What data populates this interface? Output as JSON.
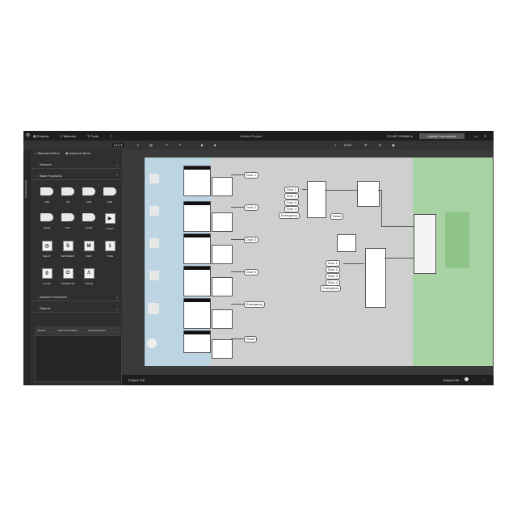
{
  "menubar": {
    "projects": "Projects",
    "modules": "Modules",
    "tools": "Tools",
    "help": "?",
    "title": "Untitled Project",
    "device": "CS-MP-C06860",
    "update_label": "Update Connections"
  },
  "toolbar": {
    "zoom_select": "X12",
    "zoom_level": "120%"
  },
  "sidebar": {
    "vertical_tab": "Project Elements",
    "radio_standard": "Standard Menu",
    "radio_advance": "Advance Menu",
    "sections": {
      "sensors": "Sensors",
      "base_functions": "Base Functions",
      "advance_functions": "Advance Functions",
      "objects": "Objects"
    },
    "base_items": [
      "AND",
      "OR",
      "XOR",
      "NOR",
      "NAND",
      "NOT",
      "NXOR",
      "START",
      "DELAY",
      "SET/RESET",
      "MEM",
      "TRUE",
      "FALSE",
      "POWER ON",
      "PULSE"
    ],
    "true_glyph": "1",
    "false_glyph": "0",
    "bottom_tabs": [
      "Events",
      "Search in Desktop",
      "Load Resources"
    ]
  },
  "diagram": {
    "outputs": [
      "Door 1",
      "Door 2",
      "Door 3",
      "Door 4",
      "Emergency",
      "Reset"
    ],
    "inputs_top": [
      "Door 1",
      "Door 2",
      "Door 3",
      "Door 4",
      "Emergency"
    ],
    "inputs_bottom": [
      "Door 1",
      "Door 2",
      "Door 3",
      "Door 4",
      "Emergency"
    ],
    "reset_label": "Reset"
  },
  "statusbar": {
    "project_tab": "Project Tab",
    "expand_all": "Expand All"
  }
}
